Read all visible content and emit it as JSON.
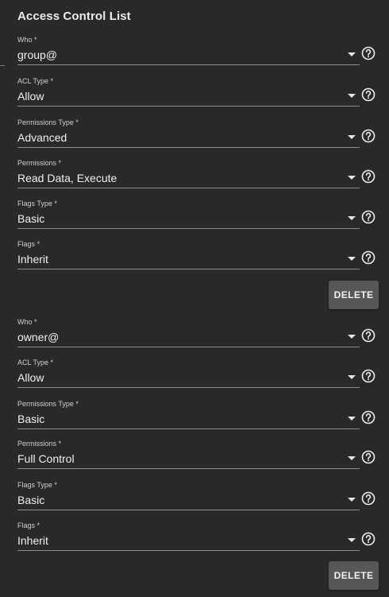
{
  "section": {
    "title": "Access Control List"
  },
  "entries": [
    {
      "fields": [
        {
          "label": "Who *",
          "value": "group@"
        },
        {
          "label": "ACL Type *",
          "value": "Allow"
        },
        {
          "label": "Permissions Type *",
          "value": "Advanced"
        },
        {
          "label": "Permissions *",
          "value": "Read Data, Execute"
        },
        {
          "label": "Flags Type *",
          "value": "Basic"
        },
        {
          "label": "Flags *",
          "value": "Inherit"
        }
      ],
      "delete_label": "DELETE"
    },
    {
      "fields": [
        {
          "label": "Who *",
          "value": "owner@"
        },
        {
          "label": "ACL Type *",
          "value": "Allow"
        },
        {
          "label": "Permissions Type *",
          "value": "Basic"
        },
        {
          "label": "Permissions *",
          "value": "Full Control"
        },
        {
          "label": "Flags Type *",
          "value": "Basic"
        },
        {
          "label": "Flags *",
          "value": "Inherit"
        }
      ],
      "delete_label": "DELETE"
    }
  ],
  "icons": {
    "dropdown": "chevron-down-icon",
    "help": "help-circle-icon"
  }
}
